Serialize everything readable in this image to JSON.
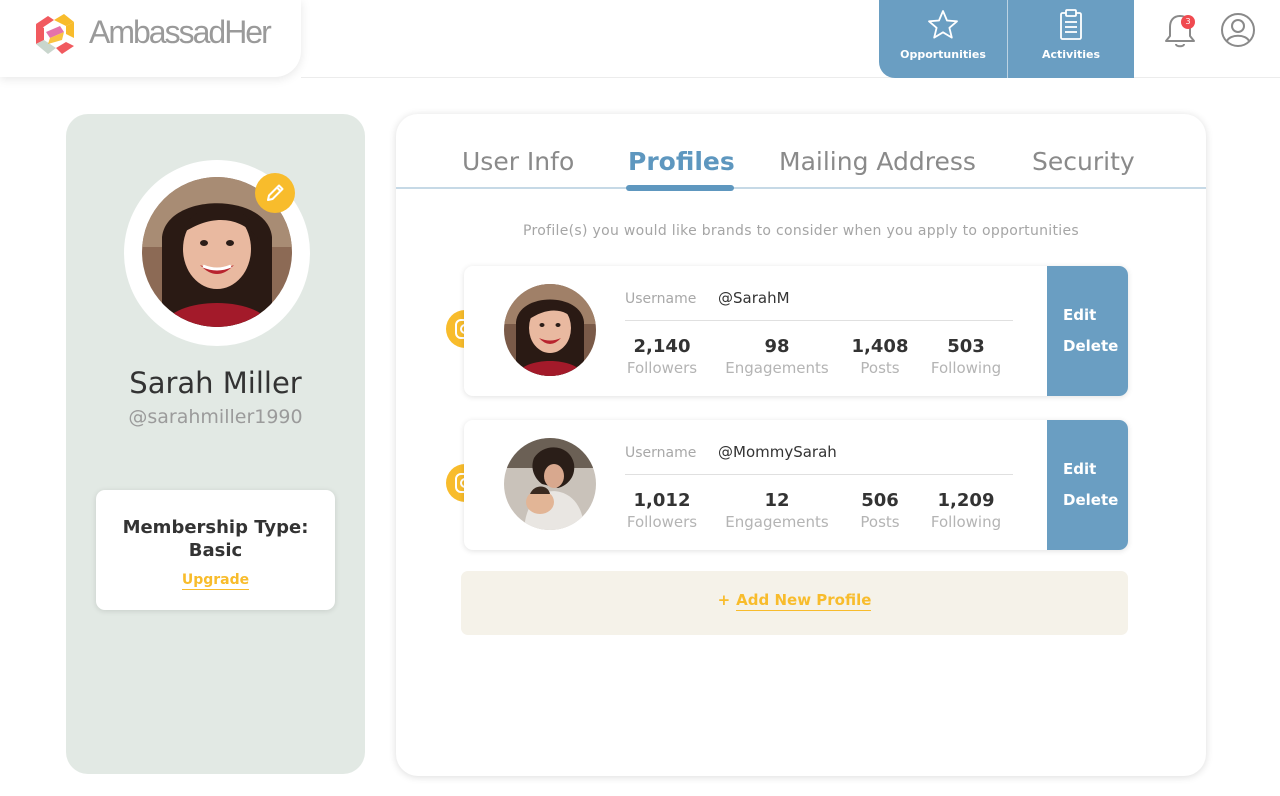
{
  "app": {
    "brand": "AmbassadHer"
  },
  "header": {
    "nav": [
      {
        "label": "Opportunities",
        "icon": "star-icon"
      },
      {
        "label": "Activities",
        "icon": "clipboard-icon"
      }
    ],
    "notifications_count": "3"
  },
  "user": {
    "name": "Sarah Miller",
    "handle": "@sarahmiller1990",
    "membership_title": "Membership Type:",
    "membership_value": "Basic",
    "upgrade_label": "Upgrade"
  },
  "tabs": [
    {
      "label": "User Info",
      "active": false
    },
    {
      "label": "Profiles",
      "active": true
    },
    {
      "label": "Mailing Address",
      "active": false
    },
    {
      "label": "Security",
      "active": false
    }
  ],
  "profiles_intro": "Profile(s) you would like brands to consider when you apply to opportunities",
  "profiles": [
    {
      "platform": "instagram",
      "username_label": "Username",
      "username": "@SarahM",
      "stats": [
        {
          "value": "2,140",
          "label": "Followers"
        },
        {
          "value": "98",
          "label": "Engagements"
        },
        {
          "value": "1,408",
          "label": "Posts"
        },
        {
          "value": "503",
          "label": "Following"
        }
      ],
      "edit_label": "Edit",
      "delete_label": "Delete"
    },
    {
      "platform": "instagram",
      "username_label": "Username",
      "username": "@MommySarah",
      "stats": [
        {
          "value": "1,012",
          "label": "Followers"
        },
        {
          "value": "12",
          "label": "Engagements"
        },
        {
          "value": "506",
          "label": "Posts"
        },
        {
          "value": "1,209",
          "label": "Following"
        }
      ],
      "edit_label": "Edit",
      "delete_label": "Delete"
    }
  ],
  "add_profile": {
    "plus": "+",
    "label": "Add New Profile"
  },
  "colors": {
    "accent_blue": "#6a9ec2",
    "accent_yellow": "#f8bc2c",
    "panel_green": "#e2e9e4",
    "add_bg": "#f5f2e9",
    "badge_red": "#f04a50"
  }
}
